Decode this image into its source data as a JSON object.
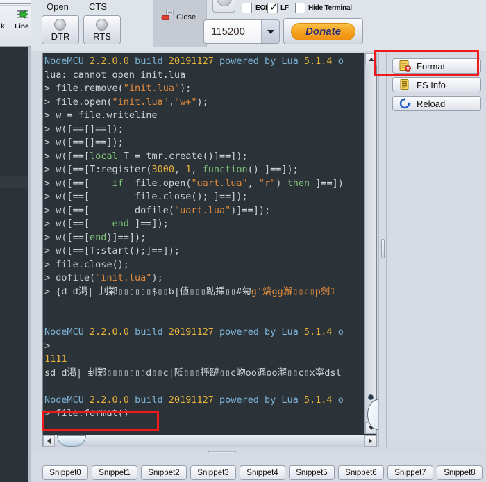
{
  "left_toolbar": {
    "icon_arrow": "green-right-arrow-icon",
    "label_k": "k",
    "label_line": "Line"
  },
  "toolbar": {
    "open_label": "Open",
    "cts_label": "CTS",
    "dtr_label": "DTR",
    "rts_label": "RTS",
    "close_label": "Close",
    "close_icon": "close-port-icon",
    "eol_label": "EOL",
    "eol_checked": false,
    "lf_label": "LF",
    "lf_checked": true,
    "hide_terminal_label": "Hide Terminal",
    "hide_terminal_checked": false,
    "baud_value": "115200",
    "donate_label": "Donate"
  },
  "terminal": {
    "lines": [
      [
        {
          "t": "NodeMCU ",
          "c": "c-blue"
        },
        {
          "t": "2.2.0.0",
          "c": "c-yel"
        },
        {
          "t": " build ",
          "c": "c-blue"
        },
        {
          "t": "20191127",
          "c": "c-yel"
        },
        {
          "t": " powered by Lua ",
          "c": "c-blue"
        },
        {
          "t": "5.1.4",
          "c": "c-yel"
        },
        {
          "t": " o",
          "c": "c-blue"
        }
      ],
      [
        {
          "t": "lua: cannot open init.lua",
          "c": "c-gry"
        }
      ],
      [
        {
          "t": "> file.remove(",
          "c": "c-gry"
        },
        {
          "t": "\"init.lua\"",
          "c": "c-org"
        },
        {
          "t": ");",
          "c": "c-gry"
        }
      ],
      [
        {
          "t": "> file.open(",
          "c": "c-gry"
        },
        {
          "t": "\"init.lua\"",
          "c": "c-org"
        },
        {
          "t": ",",
          "c": "c-gry"
        },
        {
          "t": "\"w+\"",
          "c": "c-org"
        },
        {
          "t": ");",
          "c": "c-gry"
        }
      ],
      [
        {
          "t": "> w = file.writeline",
          "c": "c-gry"
        }
      ],
      [
        {
          "t": "> w([==[]==]);",
          "c": "c-gry"
        }
      ],
      [
        {
          "t": "> w([==[]==]);",
          "c": "c-gry"
        }
      ],
      [
        {
          "t": "> w([==[",
          "c": "c-gry"
        },
        {
          "t": "local",
          "c": "c-grn"
        },
        {
          "t": " T = tmr.create()]==]);",
          "c": "c-gry"
        }
      ],
      [
        {
          "t": "> w([==[T:register(",
          "c": "c-gry"
        },
        {
          "t": "3000",
          "c": "c-yel"
        },
        {
          "t": ", ",
          "c": "c-gry"
        },
        {
          "t": "1",
          "c": "c-yel"
        },
        {
          "t": ", ",
          "c": "c-gry"
        },
        {
          "t": "function",
          "c": "c-grn"
        },
        {
          "t": "() ]==]);",
          "c": "c-gry"
        }
      ],
      [
        {
          "t": "> w([==[    ",
          "c": "c-gry"
        },
        {
          "t": "if",
          "c": "c-grn"
        },
        {
          "t": "  file.open(",
          "c": "c-gry"
        },
        {
          "t": "\"uart.lua\"",
          "c": "c-org"
        },
        {
          "t": ", ",
          "c": "c-gry"
        },
        {
          "t": "\"r\"",
          "c": "c-org"
        },
        {
          "t": ") ",
          "c": "c-gry"
        },
        {
          "t": "then",
          "c": "c-grn"
        },
        {
          "t": " ]==])",
          "c": "c-gry"
        }
      ],
      [
        {
          "t": "> w([==[        file.close(); ]==]);",
          "c": "c-gry"
        }
      ],
      [
        {
          "t": "> w([==[        dofile(",
          "c": "c-gry"
        },
        {
          "t": "\"uart.lua\"",
          "c": "c-org"
        },
        {
          "t": ")]==]);",
          "c": "c-gry"
        }
      ],
      [
        {
          "t": "> w([==[    ",
          "c": "c-gry"
        },
        {
          "t": "end",
          "c": "c-grn"
        },
        {
          "t": " ]==]);",
          "c": "c-gry"
        }
      ],
      [
        {
          "t": "> w([==[",
          "c": "c-gry"
        },
        {
          "t": "end",
          "c": "c-grn"
        },
        {
          "t": ")]==]);",
          "c": "c-gry"
        }
      ],
      [
        {
          "t": "> w([==[T:start();]==]);",
          "c": "c-gry"
        }
      ],
      [
        {
          "t": "> file.close();",
          "c": "c-gry"
        }
      ],
      [
        {
          "t": "> dofile(",
          "c": "c-gry"
        },
        {
          "t": "\"init.lua\"",
          "c": "c-org"
        },
        {
          "t": ");",
          "c": "c-gry"
        }
      ],
      [
        {
          "t": "> {d d渇| 刲鄴▯▯▯▯▯▯$▯▯b|値▯▯▯踮挿▯▯#匊",
          "c": "c-gry"
        },
        {
          "t": "g'熇gg澥▯▯c▯p剣1",
          "c": "c-org"
        }
      ],
      [
        {
          "t": "",
          "c": "c-gry"
        }
      ],
      [
        {
          "t": "",
          "c": "c-gry"
        }
      ],
      [
        {
          "t": "NodeMCU ",
          "c": "c-blue"
        },
        {
          "t": "2.2.0.0",
          "c": "c-yel"
        },
        {
          "t": " build ",
          "c": "c-blue"
        },
        {
          "t": "20191127",
          "c": "c-yel"
        },
        {
          "t": " powered by Lua ",
          "c": "c-blue"
        },
        {
          "t": "5.1.4",
          "c": "c-yel"
        },
        {
          "t": " o",
          "c": "c-blue"
        }
      ],
      [
        {
          "t": ">",
          "c": "c-gry"
        }
      ],
      [
        {
          "t": "1111",
          "c": "c-yel"
        }
      ],
      [
        {
          "t": "sd d渇| 刲鄴▯▯▯▯▯▯▯d▯▯c|阺▯▯▯掙躂▯▯c岉oo遜oo澥▯▯c▯x寧dsl",
          "c": "c-gry"
        }
      ],
      [
        {
          "t": "",
          "c": "c-gry"
        }
      ],
      [
        {
          "t": "NodeMCU ",
          "c": "c-blue"
        },
        {
          "t": "2.2.0.0",
          "c": "c-yel"
        },
        {
          "t": " build ",
          "c": "c-blue"
        },
        {
          "t": "20191127",
          "c": "c-yel"
        },
        {
          "t": " powered by Lua ",
          "c": "c-blue"
        },
        {
          "t": "5.1.4",
          "c": "c-yel"
        },
        {
          "t": " o",
          "c": "c-blue"
        }
      ],
      [
        {
          "t": "> file.format()",
          "c": "c-gry"
        }
      ]
    ]
  },
  "right_panel": {
    "buttons": [
      {
        "label": "Format",
        "icon": "format-file-delete-icon"
      },
      {
        "label": "FS Info",
        "icon": "file-info-icon"
      },
      {
        "label": "Reload",
        "icon": "reload-circular-arrow-icon"
      }
    ]
  },
  "snippets": {
    "items": [
      "Snippet0",
      "Snippet1",
      "Snippet2",
      "Snippet3",
      "Snippet4",
      "Snippet5",
      "Snippet6",
      "Snippet7",
      "Snippet8"
    ],
    "mnemonic_index": [
      -1,
      6,
      6,
      6,
      6,
      6,
      6,
      6,
      6
    ]
  },
  "annotations": {
    "highlight_color": "#f0191c",
    "boxes": [
      "format-button-highlight",
      "file-format-command-highlight"
    ]
  }
}
